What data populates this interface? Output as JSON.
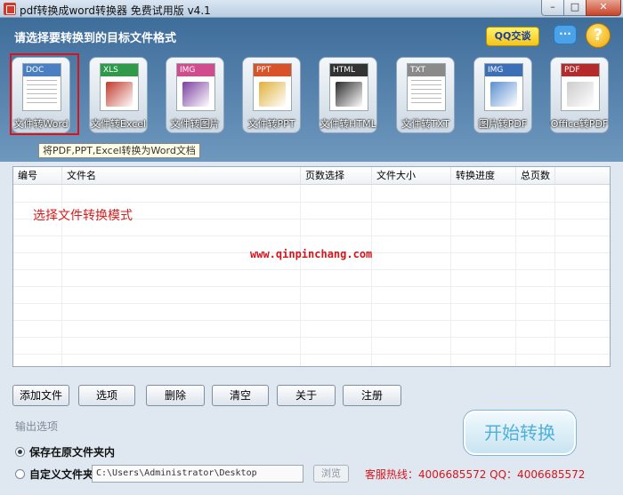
{
  "window": {
    "title": "pdf转换成word转换器 免费试用版 v4.1",
    "min_symbol": "–",
    "max_symbol": "□",
    "close_symbol": "✕"
  },
  "header": {
    "title": "请选择要转换到的目标文件格式",
    "qq_label": "QQ交谈",
    "chat_symbol": "···",
    "help_symbol": "?"
  },
  "modes": [
    {
      "tag": "DOC",
      "label": "文件转Word",
      "color": "#4a7fc1",
      "art": "#3b6db5"
    },
    {
      "tag": "XLS",
      "label": "文件转Excel",
      "color": "#2f9a4a",
      "art": "#c0392b"
    },
    {
      "tag": "IMG",
      "label": "文件转图片",
      "color": "#d14b8f",
      "art": "#7b3fa0"
    },
    {
      "tag": "PPT",
      "label": "文件转PPT",
      "color": "#d9532a",
      "art": "#e0b13a"
    },
    {
      "tag": "HTML",
      "label": "文件转HTML",
      "color": "#333333",
      "art": "#2a2a2a"
    },
    {
      "tag": "TXT",
      "label": "文件转TXT",
      "color": "#8a8a8a",
      "art": "#d7d0b8"
    },
    {
      "tag": "IMG",
      "label": "图片转PDF",
      "color": "#3d6fb8",
      "art": "#5a8fd0"
    },
    {
      "tag": "PDF",
      "label": "Office转PDF",
      "color": "#b52a2a",
      "art": "#cccccc"
    }
  ],
  "tooltip": "将PDF,PPT,Excel转换为Word文档",
  "table": {
    "columns": [
      "编号",
      "文件名",
      "页数选择",
      "文件大小",
      "转换进度",
      "总页数"
    ]
  },
  "annotation": "选择文件转换模式",
  "watermark": "www.qinpinchang.com",
  "buttons": [
    "添加文件",
    "选项",
    "删除",
    "清空",
    "关于",
    "注册"
  ],
  "output": {
    "section_label": "输出选项",
    "option_original": "保存在原文件夹内",
    "option_custom": "自定义文件夹",
    "path": "C:\\Users\\Administrator\\Desktop",
    "browse_label": "浏览"
  },
  "hotline": "客服热线：4006685572 QQ：4006685572",
  "start_label": "开始转换",
  "colors": {
    "accent_red": "#d8141b",
    "header_blue": "#3f6d9a"
  }
}
